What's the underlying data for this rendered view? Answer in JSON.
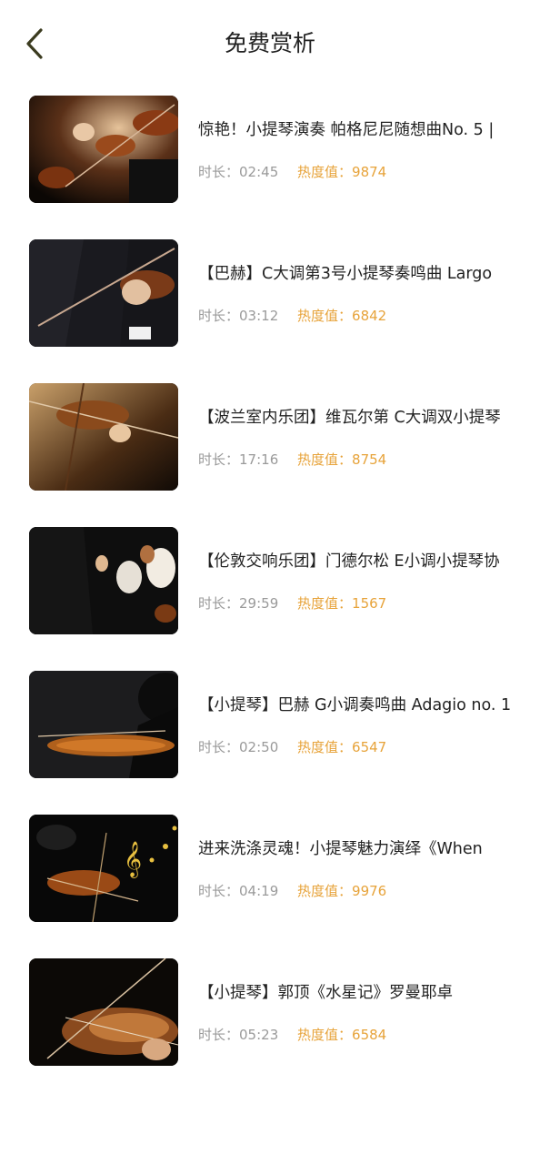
{
  "header": {
    "title": "免费赏析",
    "back_icon": "chevron-left-icon",
    "back_color": "#3b3b1f"
  },
  "labels": {
    "duration": "时长：",
    "heat": "热度值："
  },
  "colors": {
    "accent": "#e7a33a",
    "muted": "#9a9a9a",
    "title": "#222222"
  },
  "items": [
    {
      "title": "惊艳！小提琴演奏 帕格尼尼随想曲No. 5 |",
      "duration": "02:45",
      "heat": "9874"
    },
    {
      "title": "【巴赫】C大调第3号小提琴奏鸣曲 Largo",
      "duration": "03:12",
      "heat": "6842"
    },
    {
      "title": "【波兰室内乐团】维瓦尔第 C大调双小提琴",
      "duration": "17:16",
      "heat": "8754"
    },
    {
      "title": "【伦敦交响乐团】门德尔松 E小调小提琴协",
      "duration": "29:59",
      "heat": "1567"
    },
    {
      "title": "【小提琴】巴赫 G小调奏鸣曲 Adagio no. 1",
      "duration": "02:50",
      "heat": "6547"
    },
    {
      "title": "进来洗涤灵魂！小提琴魅力演绎《When",
      "duration": "04:19",
      "heat": "9976"
    },
    {
      "title": "【小提琴】郭顶《水星记》罗曼耶卓",
      "duration": "05:23",
      "heat": "6584"
    }
  ]
}
